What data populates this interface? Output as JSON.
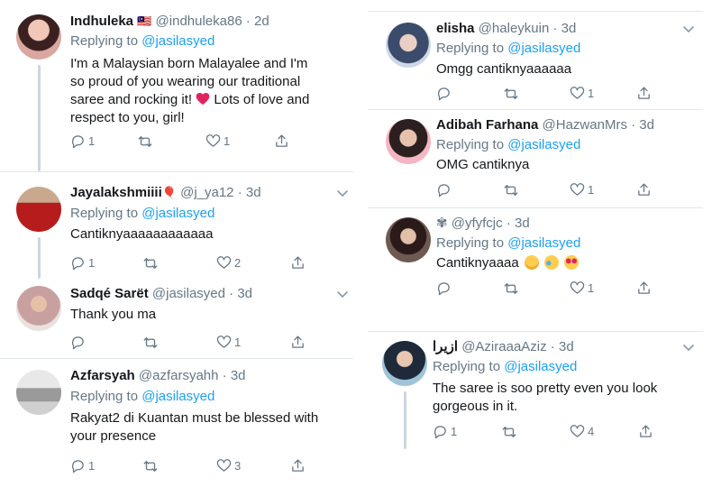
{
  "left": [
    {
      "name": "Indhuleka",
      "flag": "🇲🇾",
      "handle": "@indhuleka86",
      "time": "2d",
      "reply_prefix": "Replying to",
      "reply_to": "@jasilasyed",
      "lines": [
        "I'm a Malaysian born Malayalee and I'm",
        "so proud of you wearing our traditional",
        "saree and rocking it!"
      ],
      "heart_line_suffix": " Lots of love and",
      "last_line": "respect to you, girl!",
      "replies": "1",
      "retweets": "",
      "likes": "1"
    },
    {
      "name": "Jayalakshmiiii",
      "emoji": "🎈",
      "handle": "@j_ya12",
      "time": "3d",
      "reply_prefix": "Replying to",
      "reply_to": "@jasilasyed",
      "text": "Cantiknyaaaaaaaaaaaa",
      "replies": "1",
      "retweets": "",
      "likes": "2"
    },
    {
      "name": "Sadqé Sarët",
      "handle": "@jasilasyed",
      "time": "3d",
      "text": "Thank you ma",
      "replies": "",
      "retweets": "",
      "likes": "1"
    },
    {
      "name": "Azfarsyah",
      "handle": "@azfarsyahh",
      "time": "3d",
      "reply_prefix": "Replying to",
      "reply_to": "@jasilasyed",
      "line1": "Rakyat2 di Kuantan must be blessed with",
      "line2": "your presence",
      "replies": "1",
      "retweets": "",
      "likes": "3"
    }
  ],
  "right": [
    {
      "name": "elisha",
      "handle": "@haleykuin",
      "time": "3d",
      "reply_prefix": "Replying to",
      "reply_to": "@jasilasyed",
      "text": "Omgg cantiknyaaaaaa",
      "replies": "",
      "retweets": "",
      "likes": "1"
    },
    {
      "name": "Adibah Farhana",
      "handle": "@HazwanMrs",
      "time": "3d",
      "reply_prefix": "Replying to",
      "reply_to": "@jasilasyed",
      "text": "OMG cantiknya",
      "replies": "",
      "retweets": "",
      "likes": "1"
    },
    {
      "name": "✾",
      "handle": "@yfyfcjc",
      "time": "3d",
      "reply_prefix": "Replying to",
      "reply_to": "@jasilasyed",
      "text": "Cantiknyaaaa",
      "replies": "",
      "retweets": "",
      "likes": "1"
    },
    {
      "name": "ازيرا",
      "handle": "@AziraaaAziz",
      "time": "3d",
      "reply_prefix": "Replying to",
      "reply_to": "@jasilasyed",
      "line1": "The saree is soo pretty even you look",
      "line2": "gorgeous in it.",
      "replies": "1",
      "retweets": "",
      "likes": "4"
    }
  ],
  "colors": {
    "link": "#1da1f2",
    "muted": "#657786",
    "heart_emoji": "#e0245e",
    "divider": "#e1e8ed"
  },
  "icons": [
    "reply-icon",
    "retweet-icon",
    "like-icon",
    "share-icon",
    "chevron-down-icon",
    "heart-emoji-icon",
    "sad-emoji-icon",
    "crying-emoji-icon",
    "heart-eyes-emoji-icon"
  ]
}
